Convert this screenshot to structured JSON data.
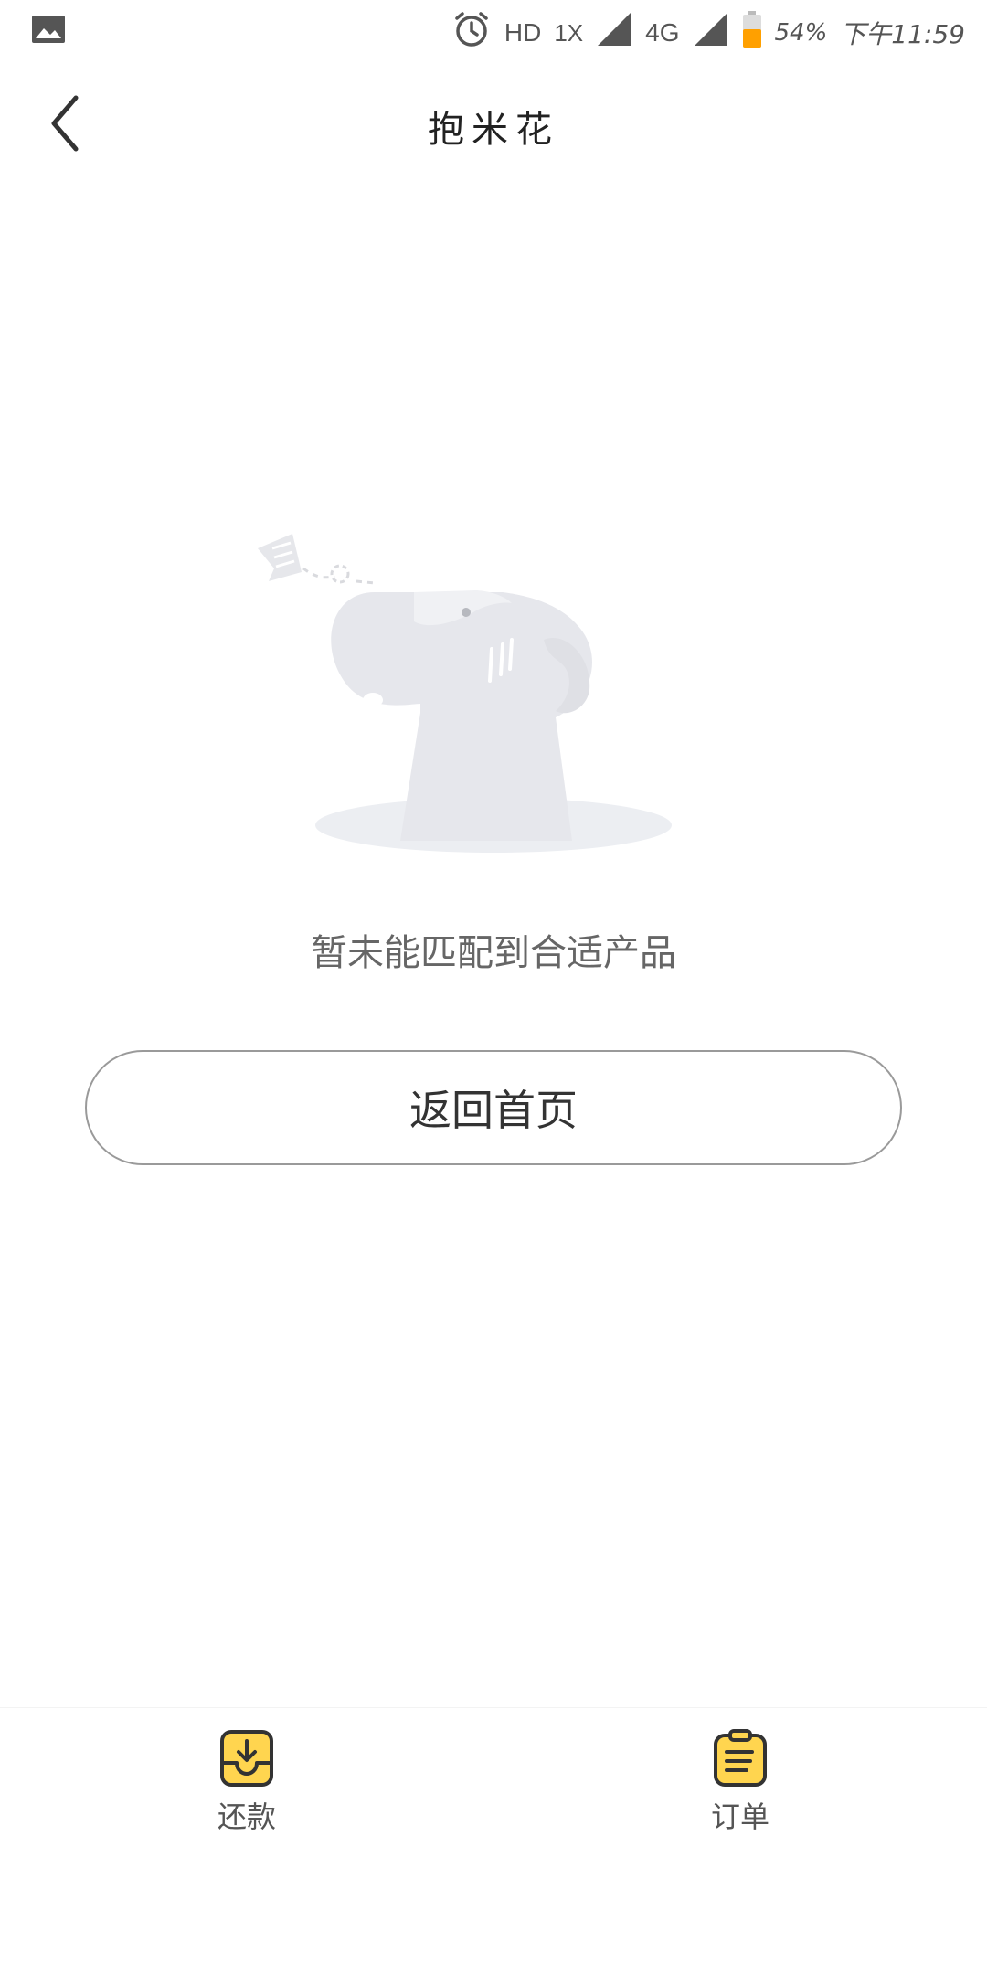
{
  "status_bar": {
    "notification_icon": "image-icon",
    "alarm_icon": "alarm-clock-icon",
    "hd": "HD",
    "sim": "1X",
    "network": "4G",
    "battery": "54%",
    "time": "下午11:59",
    "battery_color": "#FFA000"
  },
  "header": {
    "back_icon": "chevron-left-icon",
    "title": "抱米花"
  },
  "empty_state": {
    "illustration": "confused-character-icon",
    "message": "暂未能匹配到合适产品",
    "button_label": "返回首页"
  },
  "bottom_nav": {
    "accent_color": "#FFD54F",
    "items": [
      {
        "label": "还款",
        "icon": "download-tray-icon"
      },
      {
        "label": "订单",
        "icon": "clipboard-list-icon"
      }
    ]
  }
}
